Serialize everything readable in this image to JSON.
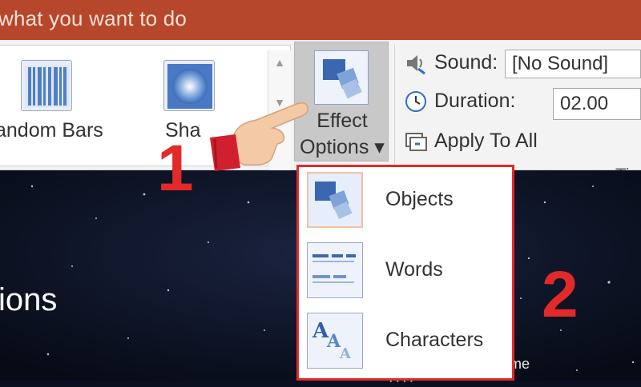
{
  "titlebar": {
    "text": "what you want to do"
  },
  "gallery": {
    "items": [
      {
        "label": "andom Bars",
        "icon": "random-bars-effect-icon"
      },
      {
        "label": "Sha",
        "icon": "shape-effect-icon"
      }
    ],
    "scroll_up": "▲",
    "scroll_down": "▼"
  },
  "effect_options": {
    "label_line1": "Effect",
    "label_line2": "Options ▾",
    "icon": "effect-options-icon"
  },
  "timing": {
    "sound_label": "Sound:",
    "sound_value": "[No Sound]",
    "duration_label": "Duration:",
    "duration_value": "02.00",
    "apply_all_label": "Apply To All",
    "group_label": "Tim"
  },
  "dropdown": {
    "items": [
      {
        "label": "Objects",
        "icon": "objects-icon",
        "selected": true
      },
      {
        "label": "Words",
        "icon": "words-icon",
        "selected": false
      },
      {
        "label": "Characters",
        "icon": "characters-icon",
        "selected": false
      }
    ],
    "more": "...."
  },
  "slide": {
    "text": "ions",
    "fragment": "me"
  },
  "annotations": {
    "step1": "1",
    "step2": "2"
  },
  "colors": {
    "titlebar": "#b7472a",
    "annotation_red": "#e22a2a",
    "effect_blue": "#4a78c4"
  }
}
